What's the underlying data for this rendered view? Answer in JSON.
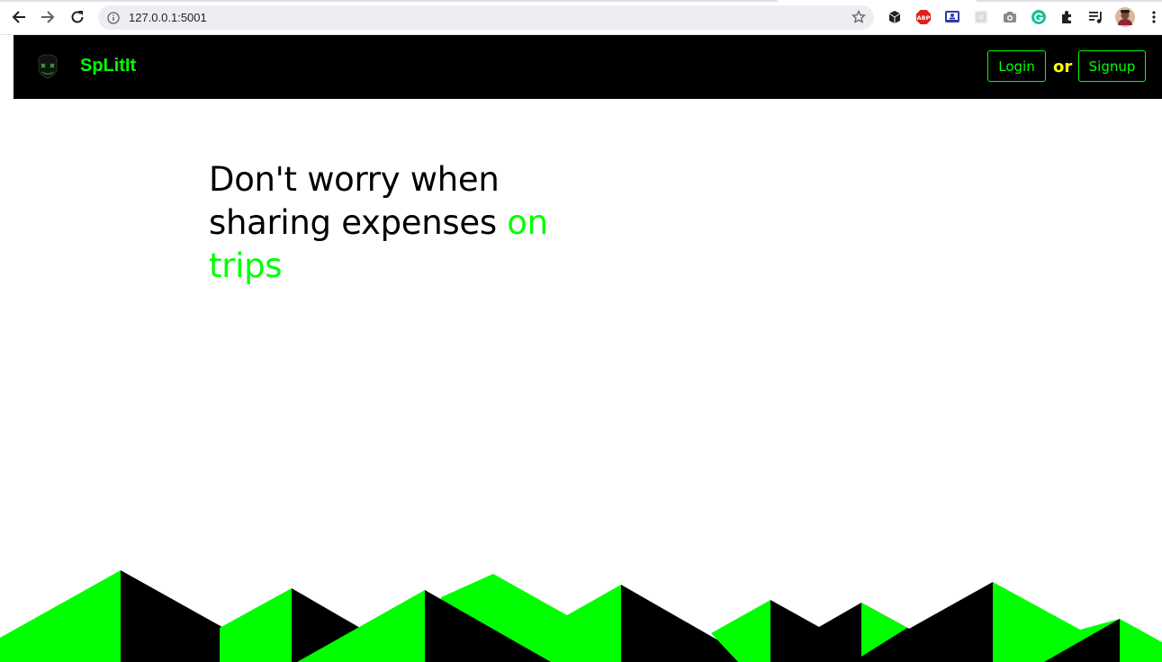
{
  "browser": {
    "url": "127.0.0.1:5001",
    "icons": [
      "back-arrow-icon",
      "forward-arrow-icon",
      "reload-icon",
      "info-icon",
      "star-icon",
      "cube-extension-icon",
      "adblock-extension-icon",
      "screen-extension-icon",
      "grid-extension-icon",
      "camera-extension-icon",
      "grammarly-extension-icon",
      "puzzle-extensions-icon",
      "media-control-icon",
      "profile-avatar",
      "menu-dots-icon"
    ],
    "adblock_label": "ABP"
  },
  "navbar": {
    "brand": "SpLitIt",
    "login_label": "Login",
    "or_label": "or",
    "signup_label": "Signup"
  },
  "hero": {
    "line1": "Don't worry when",
    "line2": "sharing expenses ",
    "accent": "on trips"
  },
  "colors": {
    "accent": "#00ff00",
    "navbar_bg": "#000000",
    "or_text": "#ffff00"
  }
}
